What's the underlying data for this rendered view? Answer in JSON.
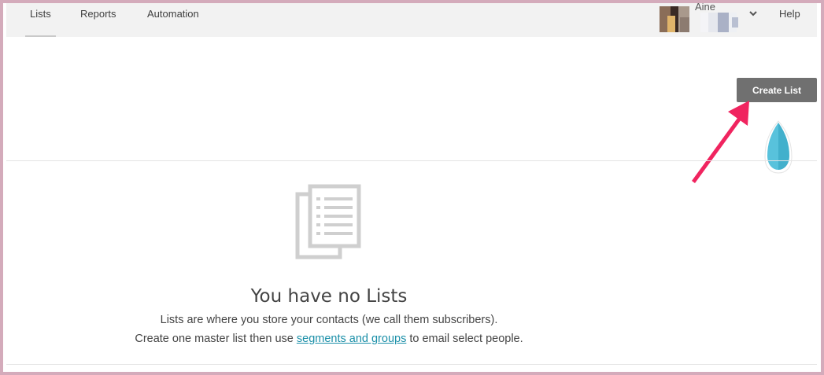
{
  "nav": {
    "tabs": [
      {
        "label": "Lists",
        "active": true
      },
      {
        "label": "Reports",
        "active": false
      },
      {
        "label": "Automation",
        "active": false
      }
    ],
    "user_name": "Aine",
    "help_label": "Help"
  },
  "toolbar": {
    "create_list_label": "Create List"
  },
  "empty_state": {
    "title": "You have no Lists",
    "line1": "Lists are where you store your contacts (we call them subscribers).",
    "line2_prefix": "Create one master list then use",
    "line2_link": "segments and groups",
    "line2_suffix": "to email select people."
  },
  "colors": {
    "nav_bg": "#f2f2f2",
    "button_bg": "#707070",
    "link": "#1a8fa8",
    "annotation_arrow": "#f0245f",
    "frame_border": "#d4abbb"
  },
  "icons": [
    "document-icon",
    "chevron-down-icon",
    "leaf-logo-icon",
    "annotation-arrow-icon"
  ]
}
